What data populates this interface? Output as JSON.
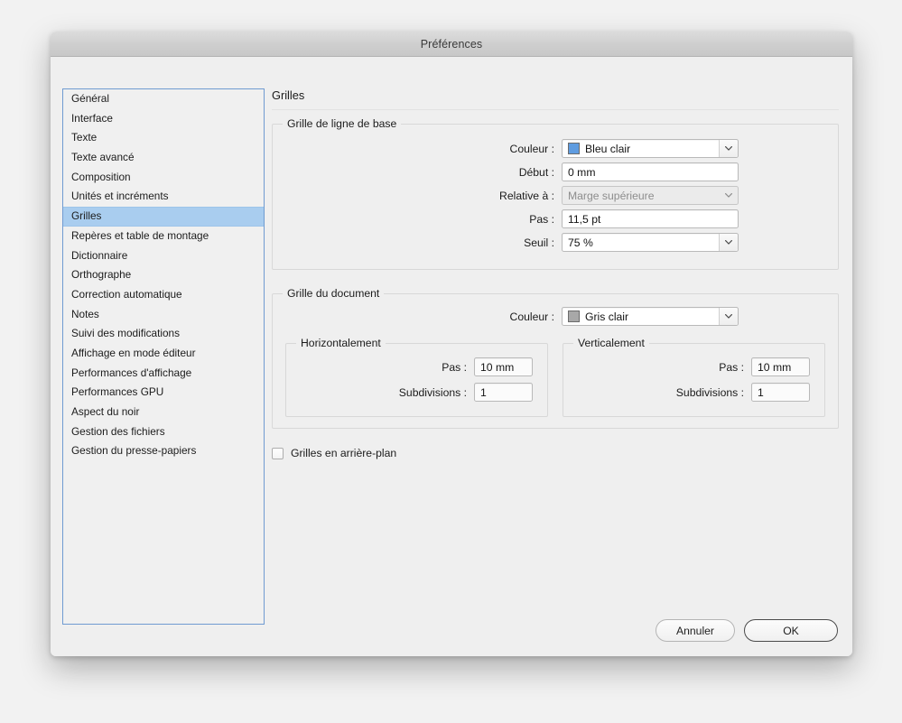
{
  "window": {
    "title": "Préférences"
  },
  "sidebar": {
    "items": [
      {
        "label": "Général",
        "selected": false
      },
      {
        "label": "Interface",
        "selected": false
      },
      {
        "label": "Texte",
        "selected": false
      },
      {
        "label": "Texte avancé",
        "selected": false
      },
      {
        "label": "Composition",
        "selected": false
      },
      {
        "label": "Unités et incréments",
        "selected": false
      },
      {
        "label": "Grilles",
        "selected": true
      },
      {
        "label": "Repères et table de montage",
        "selected": false
      },
      {
        "label": "Dictionnaire",
        "selected": false
      },
      {
        "label": "Orthographe",
        "selected": false
      },
      {
        "label": "Correction automatique",
        "selected": false
      },
      {
        "label": "Notes",
        "selected": false
      },
      {
        "label": "Suivi des modifications",
        "selected": false
      },
      {
        "label": "Affichage en mode éditeur",
        "selected": false
      },
      {
        "label": "Performances d'affichage",
        "selected": false
      },
      {
        "label": "Performances GPU",
        "selected": false
      },
      {
        "label": "Aspect du noir",
        "selected": false
      },
      {
        "label": "Gestion des fichiers",
        "selected": false
      },
      {
        "label": "Gestion du presse-papiers",
        "selected": false
      }
    ]
  },
  "pane": {
    "title": "Grilles",
    "baseline_grid": {
      "legend": "Grille de ligne de base",
      "color": {
        "label": "Couleur :",
        "value": "Bleu clair",
        "swatch_hex": "#5f9ce0"
      },
      "start": {
        "label": "Début :",
        "value": "0 mm"
      },
      "relative_to": {
        "label": "Relative à :",
        "value": "Marge supérieure",
        "disabled": true
      },
      "increment": {
        "label": "Pas :",
        "value": "11,5 pt"
      },
      "threshold": {
        "label": "Seuil :",
        "value": "75 %"
      }
    },
    "document_grid": {
      "legend": "Grille du document",
      "color": {
        "label": "Couleur :",
        "value": "Gris clair",
        "swatch_hex": "#a8a8a8"
      },
      "horizontal": {
        "legend": "Horizontalement",
        "increment": {
          "label": "Pas :",
          "value": "10 mm"
        },
        "subdivisions": {
          "label": "Subdivisions :",
          "value": "1"
        }
      },
      "vertical": {
        "legend": "Verticalement",
        "increment": {
          "label": "Pas :",
          "value": "10 mm"
        },
        "subdivisions": {
          "label": "Subdivisions :",
          "value": "1"
        }
      }
    },
    "grids_in_back": {
      "label": "Grilles en arrière-plan",
      "checked": false
    }
  },
  "footer": {
    "cancel_label": "Annuler",
    "ok_label": "OK"
  }
}
